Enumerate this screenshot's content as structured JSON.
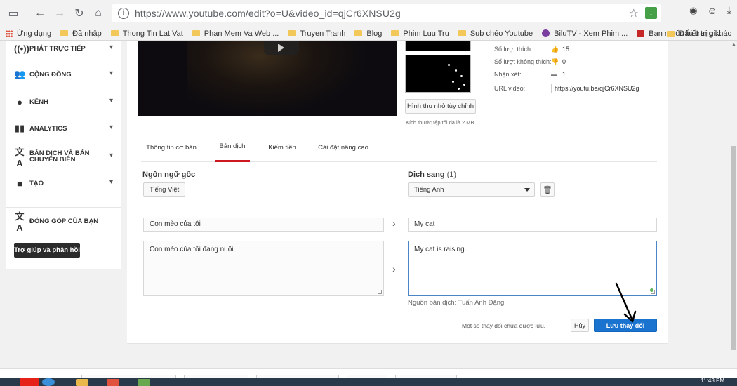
{
  "browser": {
    "url": "https://www.youtube.com/edit?o=U&video_id=qjCr6XNSU2g",
    "bookmarks": [
      {
        "label": "Ứng dụng",
        "icon": "apps-icon"
      },
      {
        "label": "Đã nhập",
        "icon": "folder-icon"
      },
      {
        "label": "Thong Tin Lat Vat",
        "icon": "folder-icon"
      },
      {
        "label": "Phan Mem Va Web ...",
        "icon": "folder-icon"
      },
      {
        "label": "Truyen Tranh",
        "icon": "folder-icon"
      },
      {
        "label": "Blog",
        "icon": "folder-icon"
      },
      {
        "label": "Phim Luu Tru",
        "icon": "folder-icon"
      },
      {
        "label": "Sub chéo Youtube",
        "icon": "folder-icon"
      },
      {
        "label": "BiluTV - Xem Phim ...",
        "icon": "film-icon"
      },
      {
        "label": "Bạn muốn biết trị gi...",
        "icon": "red-site-icon"
      }
    ],
    "bookmarks_other": "Dấu trang khác"
  },
  "sidebar": {
    "items": [
      {
        "label": "PHÁT TRỰC TIẾP",
        "icon": "live-icon"
      },
      {
        "label": "CỘNG ĐỒNG",
        "icon": "community-icon"
      },
      {
        "label": "KÊNH",
        "icon": "channel-icon"
      },
      {
        "label": "ANALYTICS",
        "icon": "analytics-icon"
      },
      {
        "label": "BẢN DỊCH VÀ BẢN CHUYỂN BIÊN",
        "icon": "translate-icon"
      },
      {
        "label": "TẠO",
        "icon": "create-icon"
      }
    ],
    "contribute": "ĐÓNG GÓP CỦA BẠN",
    "help_button": "Trợ giúp và phản hồi"
  },
  "video_info": {
    "stats": [
      {
        "label": "Số lượt thích:",
        "icon": "thumbs-up-icon",
        "value": "15"
      },
      {
        "label": "Số lượt không thích:",
        "icon": "thumbs-down-icon",
        "value": "0"
      },
      {
        "label": "Nhận xét:",
        "icon": "comment-icon",
        "value": "1"
      }
    ],
    "url_label": "URL video:",
    "url_value": "https://youtu.be/qjCr6XNSU2g",
    "custom_thumb_button": "Hình thu nhỏ tùy chỉnh",
    "size_note": "Kích thước tệp tối đa là 2 MB."
  },
  "tabs": [
    {
      "label": "Thông tin cơ bản",
      "active": false
    },
    {
      "label": "Bản dịch",
      "active": true
    },
    {
      "label": "Kiếm tiền",
      "active": false
    },
    {
      "label": "Cài đặt nâng cao",
      "active": false
    }
  ],
  "translation": {
    "source_label": "Ngôn ngữ gốc",
    "source_lang": "Tiếng Việt",
    "target_label": "Dịch sang",
    "target_count": "(1)",
    "target_lang": "Tiếng Anh",
    "source_title": "Con mèo của tôi",
    "source_desc": "Con mèo của tôi đang nuôi.",
    "target_title": "My cat",
    "target_desc": "My cat is raising.",
    "translator_note": "Nguồn bản dịch: Tuấn Anh Đặng",
    "unsaved_note": "Một số thay đổi chưa được lưu.",
    "cancel": "Hủy",
    "save": "Lưu thay đổi"
  },
  "taskbar": {
    "clock": "11:43 PM"
  },
  "colors": {
    "accent_blue": "#1b73d0",
    "tab_active_red": "#cc181e"
  }
}
